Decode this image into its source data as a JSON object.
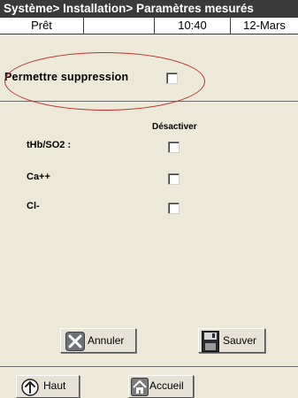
{
  "header": {
    "title": "Système> Installation> Paramètres mesurés"
  },
  "status": {
    "state": "Prêt",
    "empty_field": "",
    "time": "10:40",
    "date": "12-Mars"
  },
  "deletion": {
    "label": "Permettre suppression",
    "checked": false
  },
  "parameters": {
    "column_header": "Désactiver",
    "rows": [
      {
        "label": "tHb/SO2 :",
        "disabled": false
      },
      {
        "label": "Ca++",
        "disabled": false
      },
      {
        "label": "Cl-",
        "disabled": false
      }
    ]
  },
  "actions": {
    "cancel_label": "Annuler",
    "save_label": "Sauver"
  },
  "footer": {
    "up_label": "Haut",
    "home_label": "Accueil"
  },
  "icons": {
    "cancel": "close-x-icon",
    "save": "floppy-disk-icon",
    "up": "arrow-up-icon",
    "home": "home-icon"
  },
  "colors": {
    "title_bg": "#3a3a3a",
    "panel_bg": "#ece9d8",
    "highlight_oval": "#c0302a"
  }
}
